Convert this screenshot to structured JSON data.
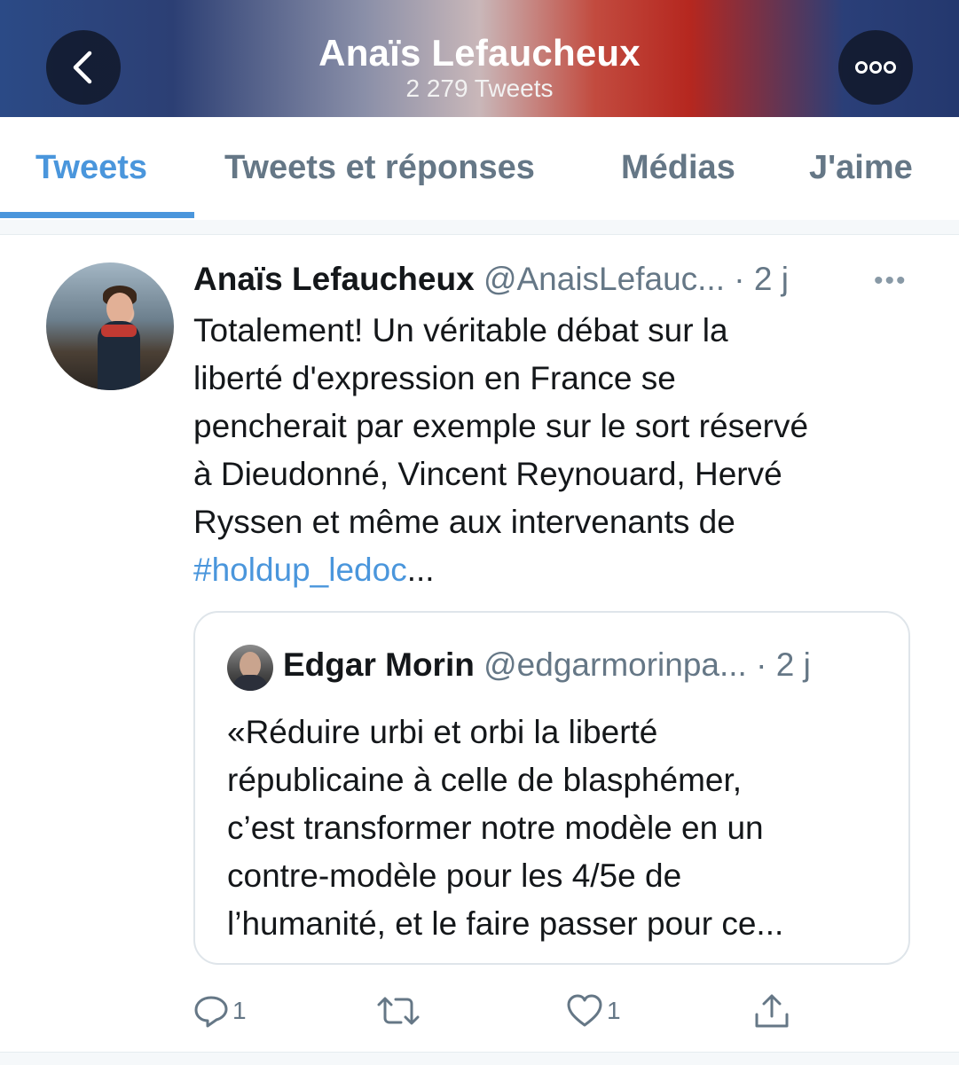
{
  "header": {
    "title": "Anaïs Lefaucheux",
    "subtitle": "2 279 Tweets",
    "back_icon": "chevron-left-icon",
    "more_icon": "more-horizontal-icon"
  },
  "tabs": [
    {
      "label": "Tweets",
      "active": true
    },
    {
      "label": "Tweets et réponses",
      "active": false
    },
    {
      "label": "Médias",
      "active": false
    },
    {
      "label": "J'aime",
      "active": false
    }
  ],
  "tweet": {
    "name": "Anaïs Lefaucheux",
    "handle": "@AnaisLefauc...",
    "time": "· 2 j",
    "more": "•••",
    "lines": [
      "Totalement! Un véritable débat sur la",
      "liberté d'expression en France se",
      "pencherait par exemple sur le sort réservé",
      "à Dieudonné, Vincent Reynouard, Hervé",
      "Ryssen et même aux intervenants de"
    ],
    "hashtag": "#holdup_ledoc",
    "ellipsis": "...",
    "quote": {
      "name": "Edgar Morin",
      "handle": "@edgarmorinpa...",
      "time": "· 2 j",
      "lines": [
        "«Réduire urbi et orbi la liberté",
        "républicaine à celle de blasphémer,",
        "c’est transformer notre modèle en un",
        "contre-modèle pour les 4/5e de",
        "l’humanité, et le faire passer pour ce..."
      ]
    },
    "actions": {
      "reply_icon": "reply-icon",
      "reply_count": "1",
      "retweet_icon": "retweet-icon",
      "like_icon": "heart-icon",
      "like_count": "1",
      "share_icon": "share-icon"
    }
  },
  "colors": {
    "accent": "#4a96dc",
    "muted": "#657786",
    "text": "#14171a"
  }
}
